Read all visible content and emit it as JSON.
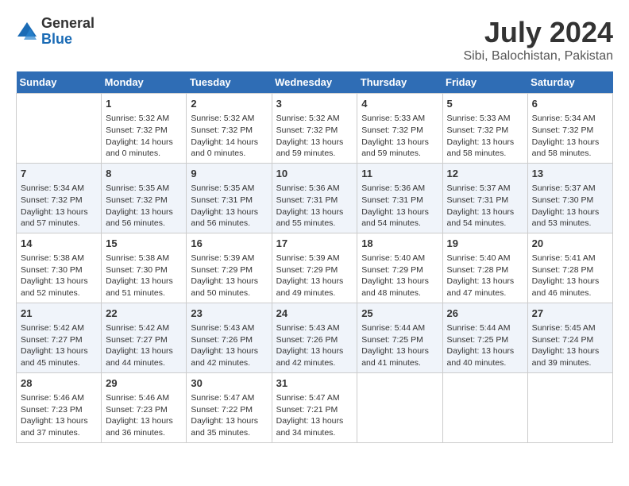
{
  "logo": {
    "line1": "General",
    "line2": "Blue"
  },
  "title": "July 2024",
  "subtitle": "Sibi, Balochistan, Pakistan",
  "days_of_week": [
    "Sunday",
    "Monday",
    "Tuesday",
    "Wednesday",
    "Thursday",
    "Friday",
    "Saturday"
  ],
  "weeks": [
    [
      {
        "day": "",
        "info": ""
      },
      {
        "day": "1",
        "info": "Sunrise: 5:32 AM\nSunset: 7:32 PM\nDaylight: 14 hours\nand 0 minutes."
      },
      {
        "day": "2",
        "info": "Sunrise: 5:32 AM\nSunset: 7:32 PM\nDaylight: 14 hours\nand 0 minutes."
      },
      {
        "day": "3",
        "info": "Sunrise: 5:32 AM\nSunset: 7:32 PM\nDaylight: 13 hours\nand 59 minutes."
      },
      {
        "day": "4",
        "info": "Sunrise: 5:33 AM\nSunset: 7:32 PM\nDaylight: 13 hours\nand 59 minutes."
      },
      {
        "day": "5",
        "info": "Sunrise: 5:33 AM\nSunset: 7:32 PM\nDaylight: 13 hours\nand 58 minutes."
      },
      {
        "day": "6",
        "info": "Sunrise: 5:34 AM\nSunset: 7:32 PM\nDaylight: 13 hours\nand 58 minutes."
      }
    ],
    [
      {
        "day": "7",
        "info": "Sunrise: 5:34 AM\nSunset: 7:32 PM\nDaylight: 13 hours\nand 57 minutes."
      },
      {
        "day": "8",
        "info": "Sunrise: 5:35 AM\nSunset: 7:32 PM\nDaylight: 13 hours\nand 56 minutes."
      },
      {
        "day": "9",
        "info": "Sunrise: 5:35 AM\nSunset: 7:31 PM\nDaylight: 13 hours\nand 56 minutes."
      },
      {
        "day": "10",
        "info": "Sunrise: 5:36 AM\nSunset: 7:31 PM\nDaylight: 13 hours\nand 55 minutes."
      },
      {
        "day": "11",
        "info": "Sunrise: 5:36 AM\nSunset: 7:31 PM\nDaylight: 13 hours\nand 54 minutes."
      },
      {
        "day": "12",
        "info": "Sunrise: 5:37 AM\nSunset: 7:31 PM\nDaylight: 13 hours\nand 54 minutes."
      },
      {
        "day": "13",
        "info": "Sunrise: 5:37 AM\nSunset: 7:30 PM\nDaylight: 13 hours\nand 53 minutes."
      }
    ],
    [
      {
        "day": "14",
        "info": "Sunrise: 5:38 AM\nSunset: 7:30 PM\nDaylight: 13 hours\nand 52 minutes."
      },
      {
        "day": "15",
        "info": "Sunrise: 5:38 AM\nSunset: 7:30 PM\nDaylight: 13 hours\nand 51 minutes."
      },
      {
        "day": "16",
        "info": "Sunrise: 5:39 AM\nSunset: 7:29 PM\nDaylight: 13 hours\nand 50 minutes."
      },
      {
        "day": "17",
        "info": "Sunrise: 5:39 AM\nSunset: 7:29 PM\nDaylight: 13 hours\nand 49 minutes."
      },
      {
        "day": "18",
        "info": "Sunrise: 5:40 AM\nSunset: 7:29 PM\nDaylight: 13 hours\nand 48 minutes."
      },
      {
        "day": "19",
        "info": "Sunrise: 5:40 AM\nSunset: 7:28 PM\nDaylight: 13 hours\nand 47 minutes."
      },
      {
        "day": "20",
        "info": "Sunrise: 5:41 AM\nSunset: 7:28 PM\nDaylight: 13 hours\nand 46 minutes."
      }
    ],
    [
      {
        "day": "21",
        "info": "Sunrise: 5:42 AM\nSunset: 7:27 PM\nDaylight: 13 hours\nand 45 minutes."
      },
      {
        "day": "22",
        "info": "Sunrise: 5:42 AM\nSunset: 7:27 PM\nDaylight: 13 hours\nand 44 minutes."
      },
      {
        "day": "23",
        "info": "Sunrise: 5:43 AM\nSunset: 7:26 PM\nDaylight: 13 hours\nand 42 minutes."
      },
      {
        "day": "24",
        "info": "Sunrise: 5:43 AM\nSunset: 7:26 PM\nDaylight: 13 hours\nand 42 minutes."
      },
      {
        "day": "25",
        "info": "Sunrise: 5:44 AM\nSunset: 7:25 PM\nDaylight: 13 hours\nand 41 minutes."
      },
      {
        "day": "26",
        "info": "Sunrise: 5:44 AM\nSunset: 7:25 PM\nDaylight: 13 hours\nand 40 minutes."
      },
      {
        "day": "27",
        "info": "Sunrise: 5:45 AM\nSunset: 7:24 PM\nDaylight: 13 hours\nand 39 minutes."
      }
    ],
    [
      {
        "day": "28",
        "info": "Sunrise: 5:46 AM\nSunset: 7:23 PM\nDaylight: 13 hours\nand 37 minutes."
      },
      {
        "day": "29",
        "info": "Sunrise: 5:46 AM\nSunset: 7:23 PM\nDaylight: 13 hours\nand 36 minutes."
      },
      {
        "day": "30",
        "info": "Sunrise: 5:47 AM\nSunset: 7:22 PM\nDaylight: 13 hours\nand 35 minutes."
      },
      {
        "day": "31",
        "info": "Sunrise: 5:47 AM\nSunset: 7:21 PM\nDaylight: 13 hours\nand 34 minutes."
      },
      {
        "day": "",
        "info": ""
      },
      {
        "day": "",
        "info": ""
      },
      {
        "day": "",
        "info": ""
      }
    ]
  ]
}
